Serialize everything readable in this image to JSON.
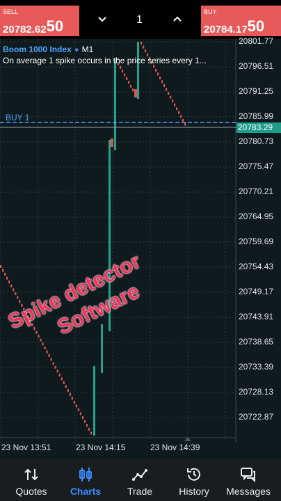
{
  "toolbar": {
    "sell_label": "SELL",
    "sell_price_main": "20782.62",
    "sell_price_big": "50",
    "buy_label": "BUY",
    "buy_price_main": "20784.17",
    "buy_price_big": "50",
    "lot_value": "1",
    "decrease_icon": "chevron-down-icon",
    "increase_icon": "chevron-up-icon"
  },
  "chart": {
    "symbol": "Boom 1000 Index",
    "timeframe": "M1",
    "description": "On average 1 spike occurs in the price series every 1...",
    "buy_line_label": "BUY 1",
    "current_price": "20783.29",
    "price_labels": [
      "20801.77",
      "20796.51",
      "20791.25",
      "20785.99",
      "20780.73",
      "20775.47",
      "20770.21",
      "20764.95",
      "20759.69",
      "20754.43",
      "20749.17",
      "20743.91",
      "20738.65",
      "20733.39",
      "20728.13",
      "20722.87"
    ],
    "time_labels": [
      "23 Nov 13:51",
      "23 Nov 14:15",
      "23 Nov 14:39"
    ],
    "colors": {
      "bull": "#1fa58e",
      "bear": "#e0574f",
      "buy_line": "#4aa3ff",
      "grid": "#2a3a3e"
    }
  },
  "overlay": {
    "line1": "Spike detector",
    "line2": "Software"
  },
  "nav": {
    "items": [
      {
        "label": "Quotes",
        "icon": "quotes-icon"
      },
      {
        "label": "Charts",
        "icon": "charts-icon"
      },
      {
        "label": "Trade",
        "icon": "trade-icon"
      },
      {
        "label": "History",
        "icon": "history-icon"
      },
      {
        "label": "Messages",
        "icon": "messages-icon"
      }
    ],
    "active": "Charts"
  }
}
